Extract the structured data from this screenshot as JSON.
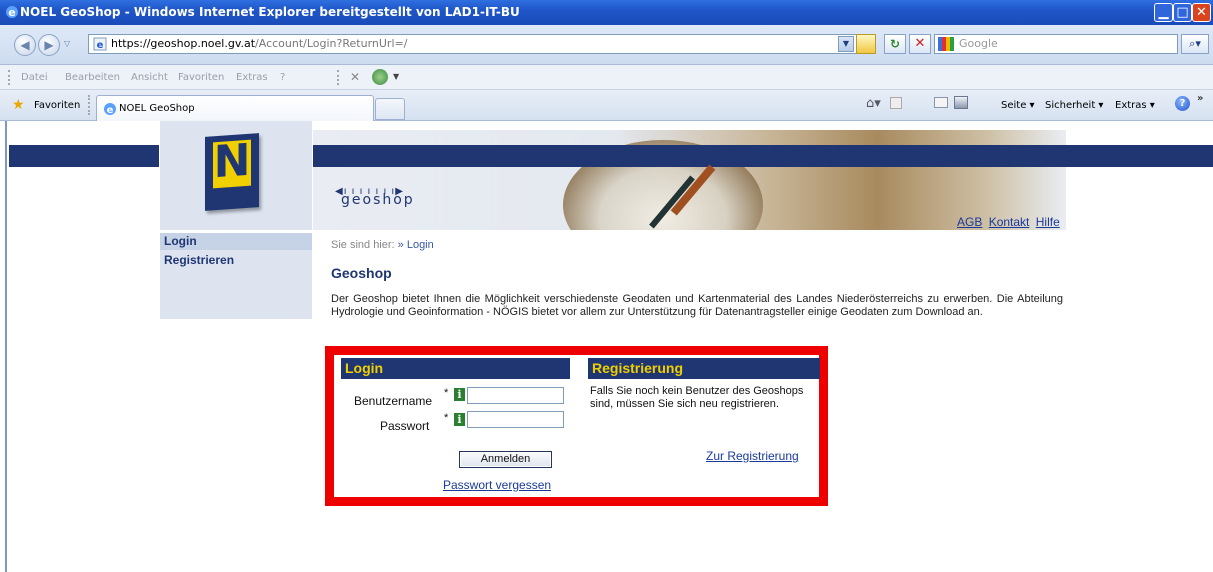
{
  "window": {
    "title": "NOEL GeoShop - Windows Internet Explorer bereitgestellt von LAD1-IT-BU"
  },
  "address": {
    "host": "https://geoshop.noel.gv.at",
    "path": "/Account/Login?ReturnUrl=/",
    "search_placeholder": "Google"
  },
  "menu": {
    "items": [
      "Datei",
      "Bearbeiten",
      "Ansicht",
      "Favoriten",
      "Extras",
      "?"
    ]
  },
  "tabs": {
    "favorites_label": "Favoriten",
    "active_tab": "NOEL GeoShop"
  },
  "commandbar": {
    "page": "Seite ▾",
    "safety": "Sicherheit ▾",
    "tools": "Extras ▾"
  },
  "site": {
    "logo_letter": "N",
    "brand_dots": "◀ı ı ı ı ı ı ı▶",
    "brand": "geoshop",
    "top_links": [
      "AGB",
      "Kontakt",
      "Hilfe"
    ],
    "nav": [
      "Login",
      "Registrieren"
    ],
    "breadcrumb_prefix": "Sie sind hier:",
    "breadcrumb_current": "» Login",
    "title": "Geoshop",
    "intro": "Der Geoshop bietet Ihnen die Möglichkeit verschiedenste Geodaten und Kartenmaterial des Landes Niederösterreichs zu erwerben. Die Abteilung Hydrologie und Geoinformation - NÖGIS bietet vor allem zur Unterstützung für Datenantragsteller einige Geodaten zum Download an."
  },
  "login": {
    "heading": "Login",
    "username_label": "Benutzername",
    "password_label": "Passwort",
    "required_mark": "*",
    "info_glyph": "i",
    "submit": "Anmelden",
    "forgot": "Passwort vergessen"
  },
  "register": {
    "heading": "Registrierung",
    "text": "Falls Sie noch kein Benutzer des Geoshops sind, müssen Sie sich neu registrieren.",
    "link": "Zur Registrierung"
  },
  "colors": {
    "navy": "#1f3673",
    "accent_yellow": "#f0d000",
    "highlight_red": "#ee0000"
  }
}
